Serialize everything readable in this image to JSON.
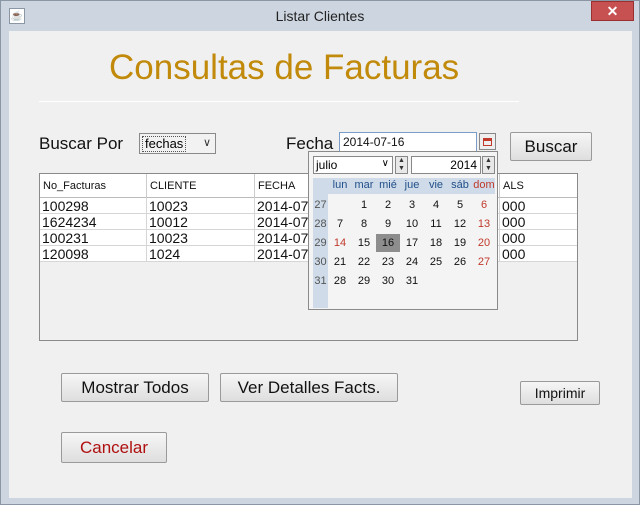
{
  "window": {
    "title": "Listar Clientes",
    "close_label": "✕"
  },
  "heading": "Consultas de Facturas",
  "search": {
    "label": "Buscar Por",
    "combo_value": "fechas",
    "date_label": "Fecha",
    "date_value": "2014-07-16",
    "button": "Buscar"
  },
  "table": {
    "headers": [
      "No_Facturas",
      "CLIENTE",
      "FECHA",
      "ALS"
    ],
    "rows": [
      [
        "100298",
        "10023",
        "2014-07",
        "000"
      ],
      [
        "1624234",
        "10012",
        "2014-07",
        "000"
      ],
      [
        "100231",
        "10023",
        "2014-07",
        "000"
      ],
      [
        "120098",
        "1024",
        "2014-07",
        "000"
      ]
    ]
  },
  "calendar": {
    "month": "julio",
    "year": "2014",
    "days_of_week": [
      "lun",
      "mar",
      "mié",
      "jue",
      "vie",
      "sáb",
      "dom"
    ],
    "weeks": [
      {
        "week": "27",
        "days": [
          "",
          "1",
          "2",
          "3",
          "4",
          "5",
          "6"
        ]
      },
      {
        "week": "28",
        "days": [
          "7",
          "8",
          "9",
          "10",
          "11",
          "12",
          "13"
        ]
      },
      {
        "week": "29",
        "days": [
          "14",
          "15",
          "16",
          "17",
          "18",
          "19",
          "20"
        ]
      },
      {
        "week": "30",
        "days": [
          "21",
          "22",
          "23",
          "24",
          "25",
          "26",
          "27"
        ]
      },
      {
        "week": "31",
        "days": [
          "28",
          "29",
          "30",
          "31",
          "",
          "",
          ""
        ]
      }
    ],
    "selected_day": "16",
    "today_day": "14"
  },
  "buttons": {
    "show_all": "Mostrar Todos",
    "details": "Ver Detalles Facts.",
    "print": "Imprimir",
    "cancel": "Cancelar"
  },
  "colors": {
    "heading": "#c28a0b",
    "cancel_text": "#b01010",
    "sunday": "#c0392b",
    "weekday_header": "#1f4f8a"
  }
}
